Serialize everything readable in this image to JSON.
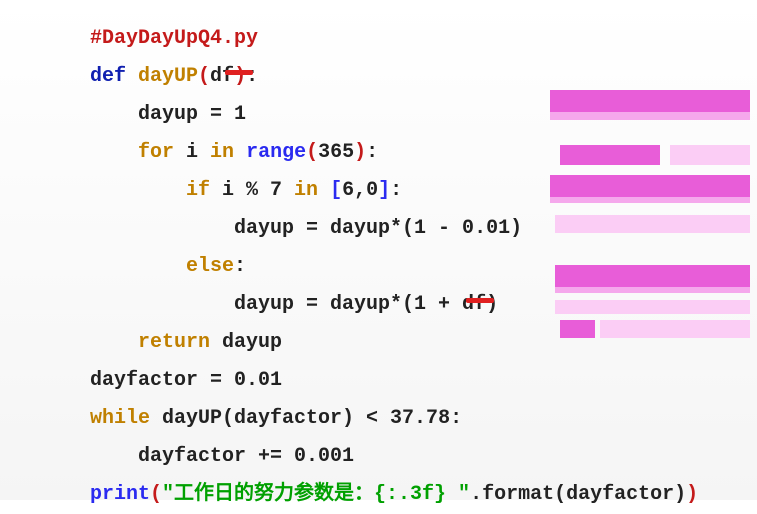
{
  "code": {
    "l1": "#DayDayUpQ4.py",
    "l2_def": "def",
    "l2_name": " dayUP",
    "l2_p_open": "(",
    "l2_param": "df",
    "l2_p_close": ")",
    "l2_colon": ":",
    "l3": "    dayup = 1",
    "l4_for": "    for",
    "l4_mid": " i ",
    "l4_in": "in",
    "l4_sp": " ",
    "l4_range": "range",
    "l4_po": "(",
    "l4_n": "365",
    "l4_pc": ")",
    "l4_c": ":",
    "l5_if": "        if",
    "l5_mid": " i % 7 ",
    "l5_in": "in",
    "l5_sp": " ",
    "l5_bo": "[",
    "l5_v": "6,0",
    "l5_bc": "]",
    "l5_c": ":",
    "l6": "            dayup = dayup*(1 - 0.01)",
    "l7_else": "        else",
    "l7_c": ":",
    "l8": "            dayup = dayup*(1 + df)",
    "l9_return": "    return",
    "l9_v": " dayup",
    "l10": "dayfactor = 0.01",
    "l11_while": "while",
    "l11_v": " dayUP(dayfactor) < 37.78:",
    "l12": "    dayfactor += 0.001",
    "l13_print": "print",
    "l13_po": "(",
    "l13_str": "\"工作日的努力参数是：{:.3f} \"",
    "l13_mid": ".format(dayfactor)",
    "l13_pc": ")"
  }
}
